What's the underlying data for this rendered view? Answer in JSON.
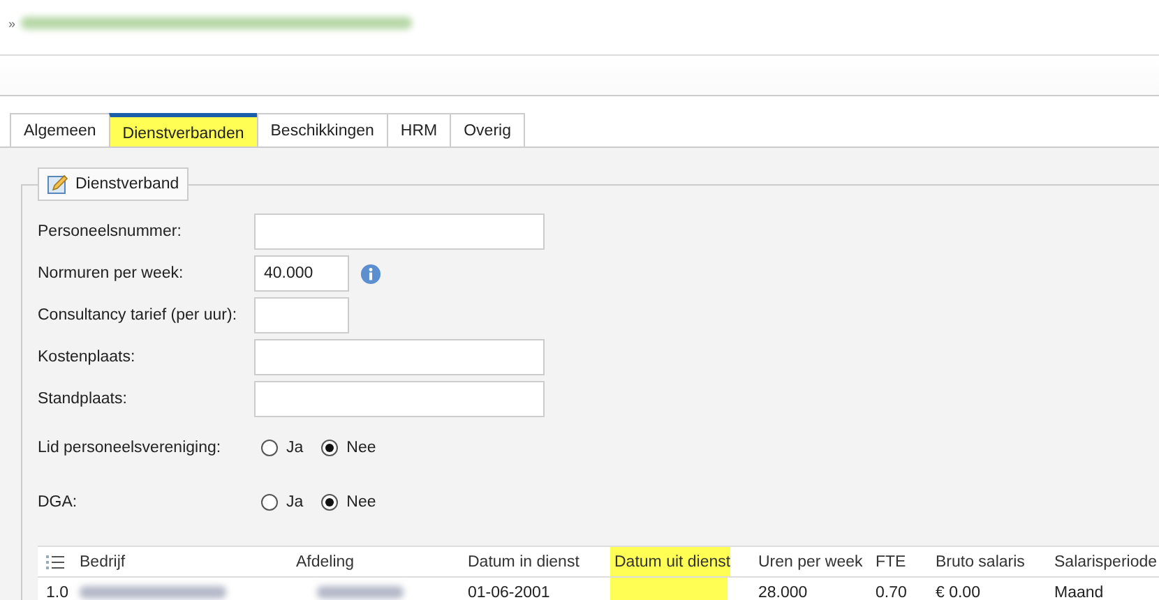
{
  "breadcrumb": {
    "separator": "»",
    "redacted": true
  },
  "tabs": [
    {
      "label": "Algemeen",
      "selected": false,
      "highlighted": false
    },
    {
      "label": "Dienstverbanden",
      "selected": true,
      "highlighted": true
    },
    {
      "label": "Beschikkingen",
      "selected": false,
      "highlighted": false
    },
    {
      "label": "HRM",
      "selected": false,
      "highlighted": false
    },
    {
      "label": "Overig",
      "selected": false,
      "highlighted": false
    }
  ],
  "fieldset": {
    "legend": "Dienstverband"
  },
  "fields": [
    {
      "kind": "wide_input",
      "label": "Personeelsnummer:"
    },
    {
      "kind": "narrow_input",
      "label": "Normuren per week:",
      "value": "40.000",
      "info": true
    },
    {
      "kind": "narrow_input",
      "label": "Consultancy tarief (per uur):"
    },
    {
      "kind": "wide_input",
      "label": "Kostenplaats:"
    },
    {
      "kind": "wide_input",
      "label": "Standplaats:"
    },
    {
      "kind": "radio",
      "label": "Lid personeelsvereniging:",
      "options": [
        {
          "label": "Ja",
          "selected": false
        },
        {
          "label": "Nee",
          "selected": true
        }
      ]
    },
    {
      "kind": "radio",
      "label": "DGA:",
      "options": [
        {
          "label": "Ja",
          "selected": false
        },
        {
          "label": "Nee",
          "selected": true
        }
      ]
    }
  ],
  "table": {
    "columns": [
      {
        "label": "Bedrijf",
        "highlighted": false
      },
      {
        "label": "Afdeling",
        "highlighted": false
      },
      {
        "label": "Datum in dienst",
        "highlighted": false
      },
      {
        "label": "Datum uit dienst",
        "highlighted": true
      },
      {
        "label": "Uren per week",
        "highlighted": false
      },
      {
        "label": "FTE",
        "highlighted": false
      },
      {
        "label": "Bruto salaris",
        "highlighted": false
      },
      {
        "label": "Salarisperiode",
        "highlighted": false
      }
    ],
    "rows": [
      {
        "number": "1.0",
        "cells": [
          {
            "kind": "redacted"
          },
          {
            "kind": "redacted"
          },
          {
            "kind": "text",
            "text": "01-06-2001"
          },
          {
            "kind": "empty"
          },
          {
            "kind": "text",
            "text": "28.000"
          },
          {
            "kind": "text",
            "text": "0.70"
          },
          {
            "kind": "text",
            "text": "€ 0.00"
          },
          {
            "kind": "text",
            "text": "Maand"
          }
        ]
      }
    ]
  }
}
